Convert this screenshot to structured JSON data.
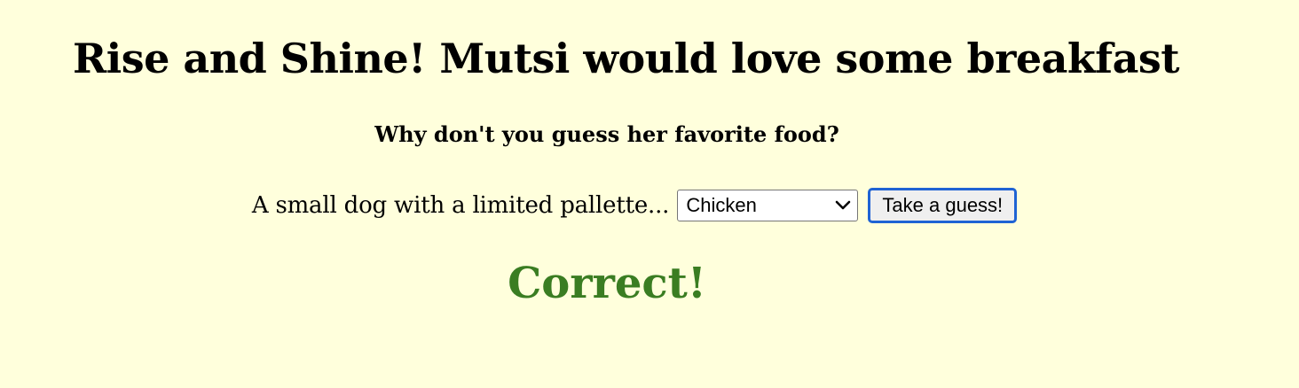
{
  "header": {
    "title": "Rise and Shine! Mutsi would love some breakfast",
    "subtitle": "Why don't you guess her favorite food?"
  },
  "form": {
    "prompt": "A small dog with a limited pallette...",
    "select": {
      "selected": "Chicken",
      "icon": "chevron-down-icon"
    },
    "submit_label": "Take a guess!"
  },
  "result": {
    "text": "Correct!",
    "color": "#3a7d22"
  },
  "colors": {
    "background": "#ffffdc",
    "button_focus_border": "#1f63d4"
  }
}
